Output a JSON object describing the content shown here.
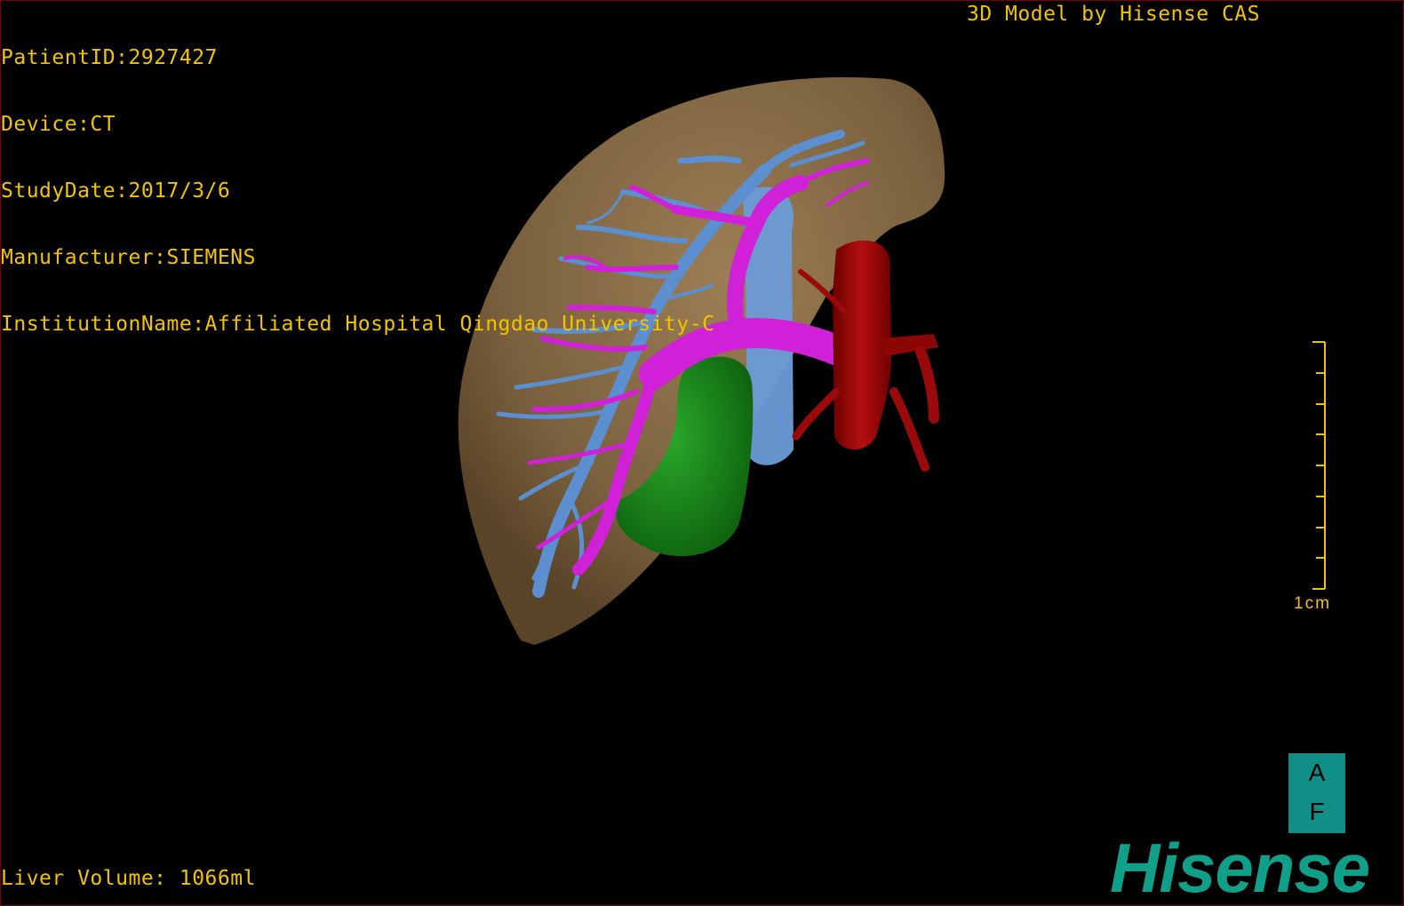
{
  "patient_info": {
    "patient_id": "PatientID:2927427",
    "device": "Device:CT",
    "study_date": "StudyDate:2017/3/6",
    "manufacturer": "Manufacturer:SIEMENS",
    "institution": "InstitutionName:Affiliated Hospital Qingdao University-C"
  },
  "brand_caption": "3D Model by Hisense CAS",
  "liver_volume": "Liver Volume: 1066ml",
  "scale_bar": {
    "label": "1cm"
  },
  "orientation": {
    "top": "A",
    "bottom": "F"
  },
  "logo": "Hisense",
  "colors": {
    "text": "#f2c400",
    "liver": "#8a6e48",
    "hepatic_vein": "#5b8fd0",
    "portal_vein": "#d020d8",
    "gallbladder": "#1e8a1e",
    "ivc_artery": "#a80b0b",
    "logo": "#10a08a"
  }
}
